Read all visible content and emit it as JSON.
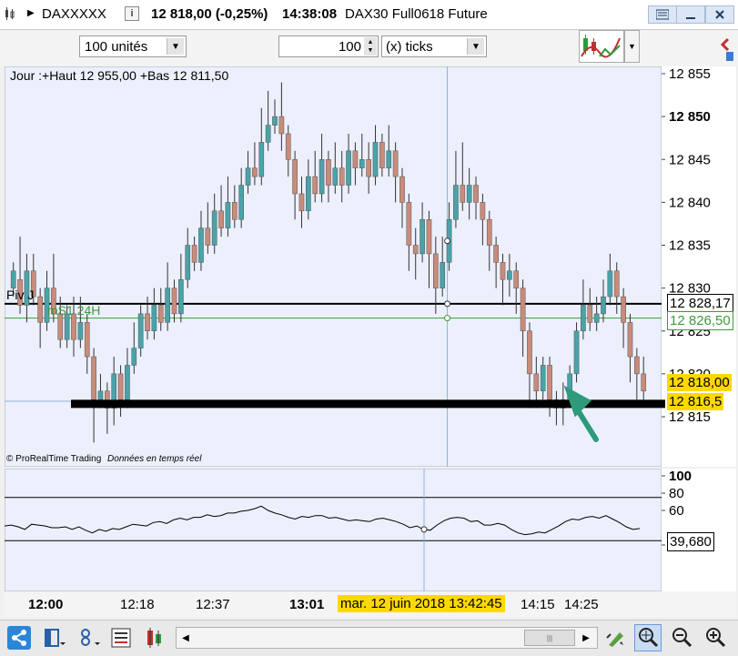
{
  "titlebar": {
    "symbol": "DAXXXXX",
    "price_change": "12 818,00 (-0,25%)",
    "time": "14:38:08",
    "instrument": "DAX30 Full0618 Future",
    "price_change_color": "#c00000"
  },
  "toolbar": {
    "units_value": "100 unités",
    "ticks_value": "100",
    "ticks_unit": "(x) ticks"
  },
  "chart": {
    "info_line": "Jour :+Haut 12 955,00 +Bas 12 811,50",
    "watermark_brand": "© ProRealTime Trading",
    "watermark_mode": "Données en temps réel",
    "pivot_label": "Piv J",
    "ms_label": "mS1 24H",
    "pivot_value": "12 828,17",
    "ms_value": "12 826,50",
    "current_value": "12 818,00",
    "support_value": "12 816,5",
    "price_axis": [
      "12 855",
      "12 850",
      "12 845",
      "12 840",
      "12 835",
      "12 830",
      "12 825",
      "12 820",
      "12 815"
    ],
    "bold_price": "12 850",
    "colors": {
      "up": "#4aa3a8",
      "down": "#c98b7a",
      "chart_bg": "#ecf0fc",
      "pivot": "#000000",
      "ms": "#3c9a3c",
      "current_box": "#ffd800",
      "arrow": "#2e9a7a"
    }
  },
  "chart_data": {
    "type": "candlestick",
    "price_range": [
      12812,
      12857
    ],
    "candles": [
      [
        12830,
        12832,
        12829,
        12833
      ],
      [
        12831,
        12828,
        12827,
        12836
      ],
      [
        12828,
        12832,
        12826,
        12834
      ],
      [
        12832,
        12829,
        12828,
        12834
      ],
      [
        12829,
        12826,
        12823,
        12830
      ],
      [
        12826,
        12830,
        12825,
        12832
      ],
      [
        12830,
        12827,
        12826,
        12834
      ],
      [
        12827,
        12824,
        12823,
        12829
      ],
      [
        12824,
        12827,
        12823,
        12828
      ],
      [
        12827,
        12824,
        12822,
        12829
      ],
      [
        12824,
        12826,
        12823,
        12829
      ],
      [
        12826,
        12822,
        12820,
        12827
      ],
      [
        12822,
        12817,
        12812,
        12823
      ],
      [
        12817,
        12818,
        12816,
        12820
      ],
      [
        12818,
        12816,
        12813,
        12819
      ],
      [
        12816,
        12820,
        12814,
        12822
      ],
      [
        12820,
        12817,
        12815,
        12821
      ],
      [
        12817,
        12821,
        12816,
        12823
      ],
      [
        12821,
        12823,
        12820,
        12826
      ],
      [
        12823,
        12827,
        12822,
        12828
      ],
      [
        12827,
        12825,
        12824,
        12829
      ],
      [
        12825,
        12828,
        12824,
        12830
      ],
      [
        12828,
        12826,
        12825,
        12830
      ],
      [
        12826,
        12830,
        12825,
        12833
      ],
      [
        12830,
        12827,
        12826,
        12831
      ],
      [
        12827,
        12831,
        12826,
        12834
      ],
      [
        12831,
        12835,
        12830,
        12837
      ],
      [
        12835,
        12833,
        12832,
        12836
      ],
      [
        12833,
        12837,
        12832,
        12839
      ],
      [
        12837,
        12835,
        12834,
        12840
      ],
      [
        12835,
        12839,
        12834,
        12841
      ],
      [
        12839,
        12837,
        12836,
        12842
      ],
      [
        12837,
        12840,
        12836,
        12843
      ],
      [
        12840,
        12838,
        12837,
        12842
      ],
      [
        12838,
        12842,
        12837,
        12844
      ],
      [
        12842,
        12844,
        12841,
        12846
      ],
      [
        12844,
        12843,
        12842,
        12847
      ],
      [
        12843,
        12847,
        12842,
        12851
      ],
      [
        12847,
        12849,
        12846,
        12853
      ],
      [
        12849,
        12850,
        12848,
        12852
      ],
      [
        12850,
        12848,
        12846,
        12854
      ],
      [
        12848,
        12845,
        12843,
        12849
      ],
      [
        12845,
        12841,
        12838,
        12846
      ],
      [
        12841,
        12839,
        12837,
        12843
      ],
      [
        12839,
        12843,
        12838,
        12845
      ],
      [
        12843,
        12841,
        12840,
        12846
      ],
      [
        12841,
        12845,
        12840,
        12848
      ],
      [
        12845,
        12842,
        12840,
        12846
      ],
      [
        12842,
        12844,
        12841,
        12847
      ],
      [
        12844,
        12842,
        12840,
        12846
      ],
      [
        12842,
        12846,
        12841,
        12848
      ],
      [
        12846,
        12844,
        12842,
        12847
      ],
      [
        12844,
        12845,
        12843,
        12848
      ],
      [
        12845,
        12843,
        12841,
        12847
      ],
      [
        12843,
        12847,
        12842,
        12849
      ],
      [
        12847,
        12844,
        12843,
        12848
      ],
      [
        12844,
        12846,
        12843,
        12849
      ],
      [
        12846,
        12843,
        12840,
        12847
      ],
      [
        12843,
        12840,
        12837,
        12844
      ],
      [
        12840,
        12835,
        12832,
        12841
      ],
      [
        12835,
        12834,
        12831,
        12837
      ],
      [
        12834,
        12838,
        12833,
        12840
      ],
      [
        12838,
        12834,
        12830,
        12839
      ],
      [
        12834,
        12830,
        12827,
        12836
      ],
      [
        12830,
        12833,
        12829,
        12836
      ],
      [
        12833,
        12838,
        12832,
        12840
      ],
      [
        12838,
        12842,
        12837,
        12846
      ],
      [
        12842,
        12840,
        12839,
        12847
      ],
      [
        12840,
        12842,
        12838,
        12844
      ],
      [
        12842,
        12840,
        12838,
        12843
      ],
      [
        12840,
        12838,
        12835,
        12841
      ],
      [
        12838,
        12835,
        12832,
        12839
      ],
      [
        12835,
        12833,
        12830,
        12836
      ],
      [
        12833,
        12831,
        12828,
        12834
      ],
      [
        12831,
        12832,
        12829,
        12834
      ],
      [
        12832,
        12830,
        12827,
        12833
      ],
      [
        12830,
        12825,
        12822,
        12831
      ],
      [
        12825,
        12820,
        12816,
        12826
      ],
      [
        12820,
        12818,
        12816,
        12822
      ],
      [
        12818,
        12821,
        12817,
        12822
      ],
      [
        12821,
        12817,
        12815,
        12822
      ],
      [
        12817,
        12816,
        12814,
        12818
      ],
      [
        12816,
        12817,
        12814,
        12819
      ],
      [
        12817,
        12820,
        12816,
        12821
      ],
      [
        12820,
        12825,
        12819,
        12826
      ],
      [
        12825,
        12828,
        12824,
        12831
      ],
      [
        12828,
        12826,
        12825,
        12830
      ],
      [
        12826,
        12827,
        12825,
        12829
      ],
      [
        12827,
        12829,
        12826,
        12831
      ],
      [
        12829,
        12832,
        12828,
        12834
      ],
      [
        12832,
        12829,
        12827,
        12833
      ],
      [
        12829,
        12826,
        12823,
        12830
      ],
      [
        12826,
        12822,
        12819,
        12827
      ],
      [
        12822,
        12820,
        12817,
        12823
      ],
      [
        12820,
        12818,
        12817,
        12822
      ]
    ],
    "indicator": {
      "name": "oscillator",
      "current": "39,680",
      "levels": [
        "100",
        "80",
        "60",
        "40",
        "20"
      ],
      "bands": [
        75,
        25
      ],
      "values": [
        42,
        43,
        41,
        38,
        44,
        43,
        42,
        40,
        40,
        41,
        38,
        41,
        37,
        34,
        38,
        36,
        39,
        38,
        41,
        44,
        43,
        42,
        46,
        47,
        45,
        49,
        51,
        49,
        52,
        52,
        55,
        53,
        54,
        57,
        57,
        59,
        60,
        62,
        65,
        60,
        57,
        55,
        52,
        50,
        53,
        52,
        54,
        54,
        51,
        52,
        50,
        48,
        49,
        48,
        47,
        50,
        51,
        49,
        47,
        44,
        40,
        42,
        38,
        37,
        43,
        48,
        51,
        52,
        51,
        47,
        48,
        43,
        43,
        45,
        43,
        38,
        34,
        32,
        33,
        35,
        34,
        38,
        42,
        47,
        50,
        49,
        52,
        53,
        51,
        54,
        50,
        46,
        41,
        38,
        39
      ],
      "range": [
        0,
        100
      ]
    },
    "time_labels": [
      "12:00",
      "12:18",
      "12:37",
      "13:01",
      "14:15",
      "14:25"
    ],
    "cursor_time": "mar. 12 juin 2018 13:42:45"
  },
  "bottombar": {
    "icons": [
      "share-icon",
      "toggle-panel-icon",
      "link-icon",
      "indicator-list-icon",
      "drawing-tools-icon"
    ]
  }
}
